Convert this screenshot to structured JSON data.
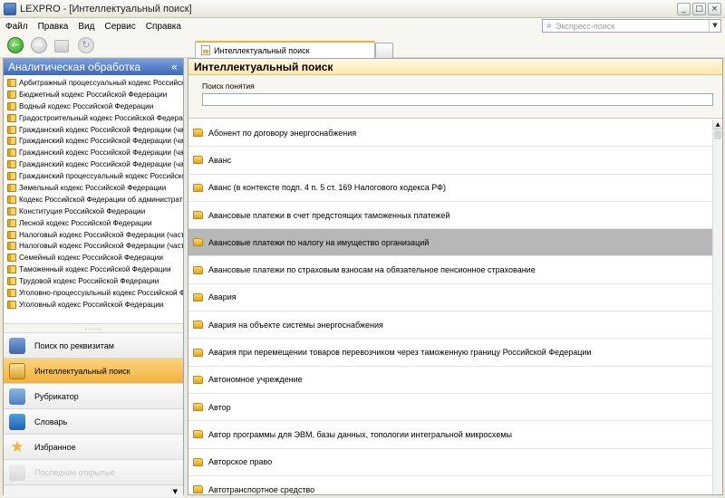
{
  "window": {
    "title": "LEXPRO - [Интеллектуальный поиск]",
    "min": "_",
    "max": "□",
    "close": "×"
  },
  "menu": [
    "Файл",
    "Правка",
    "Вид",
    "Сервис",
    "Справка"
  ],
  "express_search": {
    "placeholder": "Экспресс-поиск"
  },
  "toolbar": {
    "icons": [
      "back-icon",
      "forward-icon",
      "folder-icon",
      "refresh-icon"
    ]
  },
  "tab": {
    "label": "Интеллектуальный поиск"
  },
  "left_panel": {
    "title": "Аналитическая обработка",
    "codes": [
      "Арбитражный процессуальный кодекс Российско...",
      "Бюджетный кодекс Российской Федерации",
      "Водный кодекс Российской Федерации",
      "Градостроительный кодекс Российской Федера...",
      "Гражданский кодекс Российской Федерации (час...",
      "Гражданский кодекс Российской Федерации (час...",
      "Гражданский кодекс Российской Федерации (час...",
      "Гражданский кодекс Российской Федерации (час...",
      "Гражданский процессуальный кодекс Российско...",
      "Земельный кодекс Российской Федерации",
      "Кодекс Российской Федерации об администрати...",
      "Конституция Российской Федерации",
      "Лесной кодекс Российской Федерации",
      "Налоговый кодекс Российской Федерации (част...",
      "Налоговый кодекс Российской Федерации (част...",
      "Семейный кодекс Российской Федерации",
      "Таможенный кодекс Российской Федерации",
      "Трудовой кодекс Российской Федерации",
      "Уголовно-процессуальный кодекс Российской Ф...",
      "Уголовный кодекс Российской Федерации"
    ],
    "nav": [
      {
        "label": "Поиск по реквизитам",
        "icon": "search-requisites-icon"
      },
      {
        "label": "Интеллектуальный поиск",
        "icon": "intellectual-search-icon",
        "active": true
      },
      {
        "label": "Рубрикатор",
        "icon": "rubricator-icon"
      },
      {
        "label": "Словарь",
        "icon": "dictionary-icon"
      },
      {
        "label": "Избранное",
        "icon": "star-icon"
      },
      {
        "label": "Последние открытые",
        "icon": "recent-icon",
        "disabled": true
      }
    ]
  },
  "main": {
    "title": "Интеллектуальный поиск",
    "search_label": "Поиск понятия",
    "results": [
      "Абонент по договору энергоснабжения",
      "Аванс",
      "Аванс (в контексте подп. 4 п. 5 ст. 169 Налогового кодекса РФ)",
      "Авансовые платежи в счет предстоящих таможенных платежей",
      "Авансовые платежи по налогу на имущество организаций",
      "Авансовые платежи по страховым взносам на обязательное пенсионное страхование",
      "Авария",
      "Авария на объекте системы энергоснабжения",
      "Авария при перемещении товаров перевозчиком через таможенную границу Российской Федерации",
      "Автономное учреждение",
      "Автор",
      "Автор программы для ЭВМ, базы данных, топологии интегральной микросхемы",
      "Авторское право",
      "Автотранспортное средство"
    ],
    "selected_index": 4
  }
}
